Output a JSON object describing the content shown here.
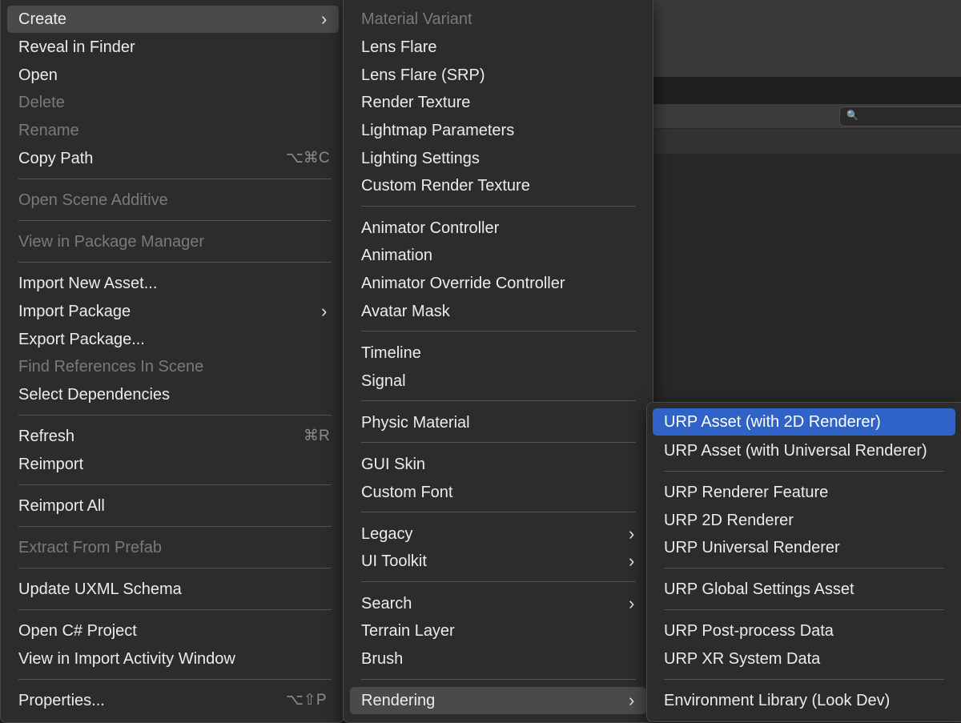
{
  "menu1": {
    "items": [
      {
        "label": "Create",
        "submenu_glyph": "›"
      },
      {
        "label": "Reveal in Finder"
      },
      {
        "label": "Open"
      },
      {
        "label": "Delete"
      },
      {
        "label": "Rename"
      },
      {
        "label": "Copy Path",
        "shortcut": "⌥⌘C"
      },
      {
        "label": "Open Scene Additive"
      },
      {
        "label": "View in Package Manager"
      },
      {
        "label": "Import New Asset..."
      },
      {
        "label": "Import Package",
        "submenu_glyph": "›"
      },
      {
        "label": "Export Package..."
      },
      {
        "label": "Find References In Scene"
      },
      {
        "label": "Select Dependencies"
      },
      {
        "label": "Refresh",
        "shortcut": "⌘R"
      },
      {
        "label": "Reimport"
      },
      {
        "label": "Reimport All"
      },
      {
        "label": "Extract From Prefab"
      },
      {
        "label": "Update UXML Schema"
      },
      {
        "label": "Open C# Project"
      },
      {
        "label": "View in Import Activity Window"
      },
      {
        "label": "Properties...",
        "shortcut": "⌥⇧P"
      }
    ]
  },
  "menu2": {
    "items": [
      {
        "label": "Material Variant"
      },
      {
        "label": "Lens Flare"
      },
      {
        "label": "Lens Flare (SRP)"
      },
      {
        "label": "Render Texture"
      },
      {
        "label": "Lightmap Parameters"
      },
      {
        "label": "Lighting Settings"
      },
      {
        "label": "Custom Render Texture"
      },
      {
        "label": "Animator Controller"
      },
      {
        "label": "Animation"
      },
      {
        "label": "Animator Override Controller"
      },
      {
        "label": "Avatar Mask"
      },
      {
        "label": "Timeline"
      },
      {
        "label": "Signal"
      },
      {
        "label": "Physic Material"
      },
      {
        "label": "GUI Skin"
      },
      {
        "label": "Custom Font"
      },
      {
        "label": "Legacy",
        "submenu_glyph": "›"
      },
      {
        "label": "UI Toolkit",
        "submenu_glyph": "›"
      },
      {
        "label": "Search",
        "submenu_glyph": "›"
      },
      {
        "label": "Terrain Layer"
      },
      {
        "label": "Brush"
      },
      {
        "label": "Rendering",
        "submenu_glyph": "›"
      }
    ]
  },
  "menu3": {
    "items": [
      {
        "label": "URP Asset (with 2D Renderer)"
      },
      {
        "label": "URP Asset (with Universal Renderer)"
      },
      {
        "label": "URP Renderer Feature"
      },
      {
        "label": "URP 2D Renderer"
      },
      {
        "label": "URP Universal Renderer"
      },
      {
        "label": "URP Global Settings Asset"
      },
      {
        "label": "URP Post-process Data"
      },
      {
        "label": "URP XR System Data"
      },
      {
        "label": "Environment Library (Look Dev)"
      }
    ]
  },
  "search_icon_glyph": "🔍",
  "colors": {
    "menu_bg": "#2c2c2c",
    "highlight_blue": "#2f63c7",
    "highlight_gray": "#4a4a4a",
    "disabled_text": "#7a7a7a"
  }
}
